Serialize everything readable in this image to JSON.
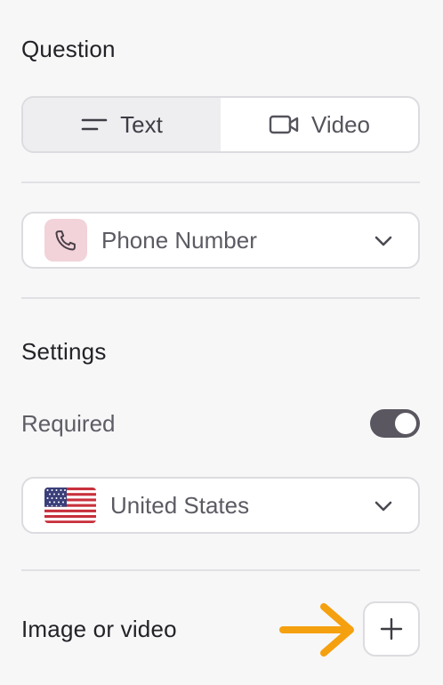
{
  "question": {
    "title": "Question",
    "tabs": [
      {
        "label": "Text",
        "icon": "text-lines-icon",
        "active": true
      },
      {
        "label": "Video",
        "icon": "video-camera-icon",
        "active": false
      }
    ]
  },
  "answer_type": {
    "label": "Phone Number",
    "icon": "phone-icon",
    "badge_color": "#f2d3da"
  },
  "settings": {
    "title": "Settings",
    "required_label": "Required",
    "required_on": true,
    "country": {
      "label": "United States",
      "icon": "us-flag-icon"
    }
  },
  "media": {
    "label": "Image or video",
    "add_icon": "plus-icon",
    "annotation_color": "#f5a00f"
  }
}
